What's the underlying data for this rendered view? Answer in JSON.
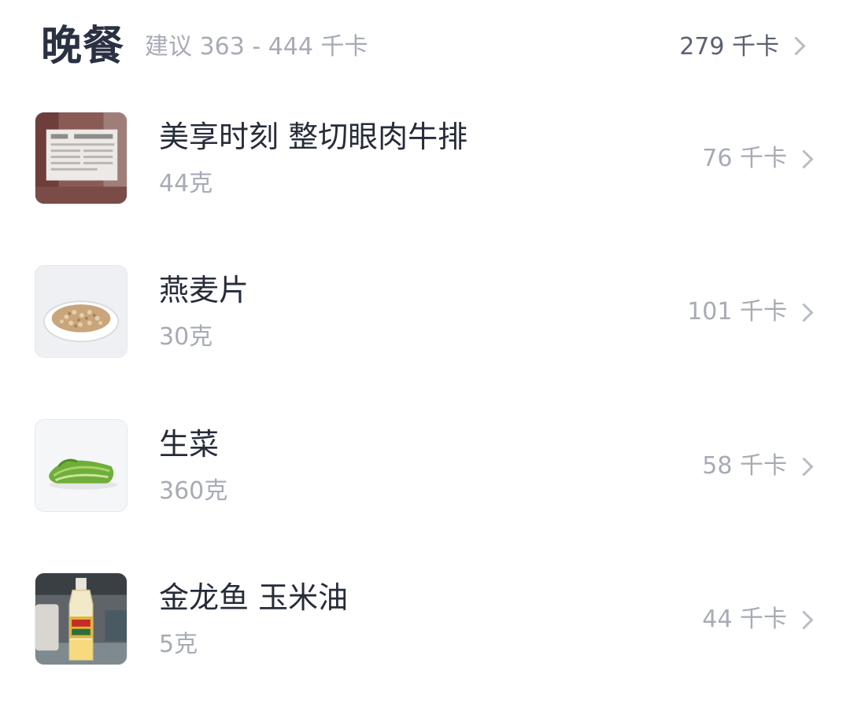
{
  "meal": {
    "title": "晚餐",
    "suggestion": "建议 363 - 444 千卡",
    "total": "279 千卡"
  },
  "items": [
    {
      "name": "美享时刻 整切眼肉牛排",
      "amount": "44克",
      "kcal": "76 千卡",
      "thumb_icon": "steak-package-icon"
    },
    {
      "name": "燕麦片",
      "amount": "30克",
      "kcal": "101 千卡",
      "thumb_icon": "oatmeal-plate-icon"
    },
    {
      "name": "生菜",
      "amount": "360克",
      "kcal": "58 千卡",
      "thumb_icon": "lettuce-icon"
    },
    {
      "name": "金龙鱼 玉米油",
      "amount": "5克",
      "kcal": "44 千卡",
      "thumb_icon": "corn-oil-bottle-icon"
    }
  ],
  "colors": {
    "title": "#2a3142",
    "secondary": "#a7abb4",
    "chevron": "#b9bdc5"
  }
}
